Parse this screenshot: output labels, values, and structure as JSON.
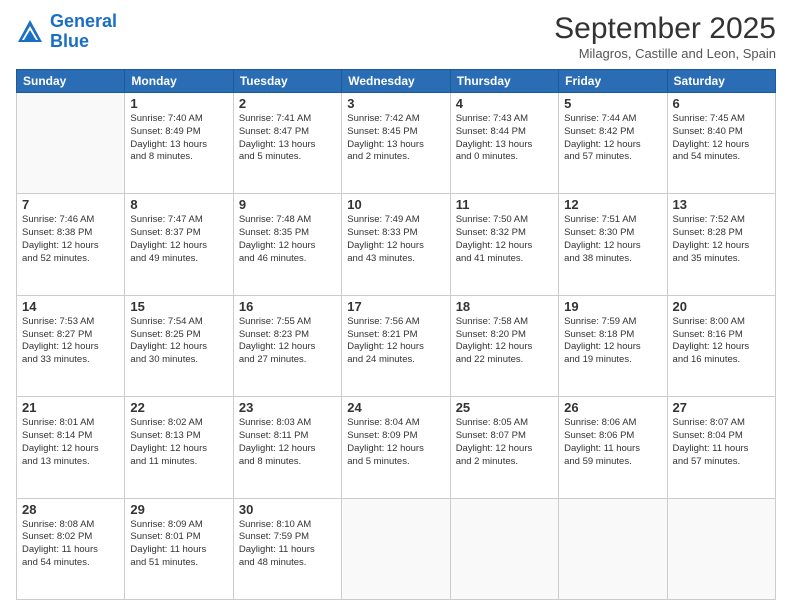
{
  "header": {
    "logo_line1": "General",
    "logo_line2": "Blue",
    "month": "September 2025",
    "location": "Milagros, Castille and Leon, Spain"
  },
  "weekdays": [
    "Sunday",
    "Monday",
    "Tuesday",
    "Wednesday",
    "Thursday",
    "Friday",
    "Saturday"
  ],
  "weeks": [
    [
      {
        "day": "",
        "info": ""
      },
      {
        "day": "1",
        "info": "Sunrise: 7:40 AM\nSunset: 8:49 PM\nDaylight: 13 hours\nand 8 minutes."
      },
      {
        "day": "2",
        "info": "Sunrise: 7:41 AM\nSunset: 8:47 PM\nDaylight: 13 hours\nand 5 minutes."
      },
      {
        "day": "3",
        "info": "Sunrise: 7:42 AM\nSunset: 8:45 PM\nDaylight: 13 hours\nand 2 minutes."
      },
      {
        "day": "4",
        "info": "Sunrise: 7:43 AM\nSunset: 8:44 PM\nDaylight: 13 hours\nand 0 minutes."
      },
      {
        "day": "5",
        "info": "Sunrise: 7:44 AM\nSunset: 8:42 PM\nDaylight: 12 hours\nand 57 minutes."
      },
      {
        "day": "6",
        "info": "Sunrise: 7:45 AM\nSunset: 8:40 PM\nDaylight: 12 hours\nand 54 minutes."
      }
    ],
    [
      {
        "day": "7",
        "info": "Sunrise: 7:46 AM\nSunset: 8:38 PM\nDaylight: 12 hours\nand 52 minutes."
      },
      {
        "day": "8",
        "info": "Sunrise: 7:47 AM\nSunset: 8:37 PM\nDaylight: 12 hours\nand 49 minutes."
      },
      {
        "day": "9",
        "info": "Sunrise: 7:48 AM\nSunset: 8:35 PM\nDaylight: 12 hours\nand 46 minutes."
      },
      {
        "day": "10",
        "info": "Sunrise: 7:49 AM\nSunset: 8:33 PM\nDaylight: 12 hours\nand 43 minutes."
      },
      {
        "day": "11",
        "info": "Sunrise: 7:50 AM\nSunset: 8:32 PM\nDaylight: 12 hours\nand 41 minutes."
      },
      {
        "day": "12",
        "info": "Sunrise: 7:51 AM\nSunset: 8:30 PM\nDaylight: 12 hours\nand 38 minutes."
      },
      {
        "day": "13",
        "info": "Sunrise: 7:52 AM\nSunset: 8:28 PM\nDaylight: 12 hours\nand 35 minutes."
      }
    ],
    [
      {
        "day": "14",
        "info": "Sunrise: 7:53 AM\nSunset: 8:27 PM\nDaylight: 12 hours\nand 33 minutes."
      },
      {
        "day": "15",
        "info": "Sunrise: 7:54 AM\nSunset: 8:25 PM\nDaylight: 12 hours\nand 30 minutes."
      },
      {
        "day": "16",
        "info": "Sunrise: 7:55 AM\nSunset: 8:23 PM\nDaylight: 12 hours\nand 27 minutes."
      },
      {
        "day": "17",
        "info": "Sunrise: 7:56 AM\nSunset: 8:21 PM\nDaylight: 12 hours\nand 24 minutes."
      },
      {
        "day": "18",
        "info": "Sunrise: 7:58 AM\nSunset: 8:20 PM\nDaylight: 12 hours\nand 22 minutes."
      },
      {
        "day": "19",
        "info": "Sunrise: 7:59 AM\nSunset: 8:18 PM\nDaylight: 12 hours\nand 19 minutes."
      },
      {
        "day": "20",
        "info": "Sunrise: 8:00 AM\nSunset: 8:16 PM\nDaylight: 12 hours\nand 16 minutes."
      }
    ],
    [
      {
        "day": "21",
        "info": "Sunrise: 8:01 AM\nSunset: 8:14 PM\nDaylight: 12 hours\nand 13 minutes."
      },
      {
        "day": "22",
        "info": "Sunrise: 8:02 AM\nSunset: 8:13 PM\nDaylight: 12 hours\nand 11 minutes."
      },
      {
        "day": "23",
        "info": "Sunrise: 8:03 AM\nSunset: 8:11 PM\nDaylight: 12 hours\nand 8 minutes."
      },
      {
        "day": "24",
        "info": "Sunrise: 8:04 AM\nSunset: 8:09 PM\nDaylight: 12 hours\nand 5 minutes."
      },
      {
        "day": "25",
        "info": "Sunrise: 8:05 AM\nSunset: 8:07 PM\nDaylight: 12 hours\nand 2 minutes."
      },
      {
        "day": "26",
        "info": "Sunrise: 8:06 AM\nSunset: 8:06 PM\nDaylight: 11 hours\nand 59 minutes."
      },
      {
        "day": "27",
        "info": "Sunrise: 8:07 AM\nSunset: 8:04 PM\nDaylight: 11 hours\nand 57 minutes."
      }
    ],
    [
      {
        "day": "28",
        "info": "Sunrise: 8:08 AM\nSunset: 8:02 PM\nDaylight: 11 hours\nand 54 minutes."
      },
      {
        "day": "29",
        "info": "Sunrise: 8:09 AM\nSunset: 8:01 PM\nDaylight: 11 hours\nand 51 minutes."
      },
      {
        "day": "30",
        "info": "Sunrise: 8:10 AM\nSunset: 7:59 PM\nDaylight: 11 hours\nand 48 minutes."
      },
      {
        "day": "",
        "info": ""
      },
      {
        "day": "",
        "info": ""
      },
      {
        "day": "",
        "info": ""
      },
      {
        "day": "",
        "info": ""
      }
    ]
  ]
}
